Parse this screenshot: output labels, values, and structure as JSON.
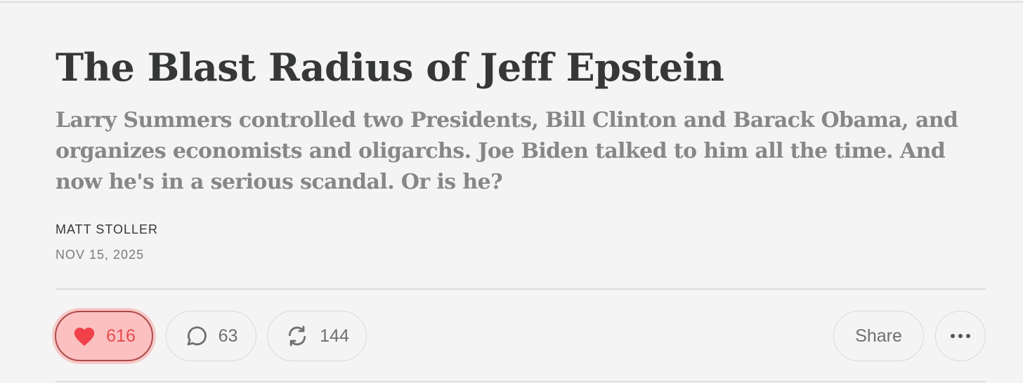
{
  "article": {
    "title": "The Blast Radius of Jeff Epstein",
    "subtitle": "Larry Summers controlled two Presidents, Bill Clinton and Barack Obama, and organizes economists and oligarchs. Joe Biden talked to him all the time. And now he's in a serious scandal. Or is he?",
    "author": "Matt Stoller",
    "date": "Nov 15, 2025"
  },
  "actions": {
    "like_count": "616",
    "comment_count": "63",
    "restack_count": "144",
    "share_label": "Share",
    "more_icon": "ellipsis-icon"
  },
  "colors": {
    "background": "#f4f4f4",
    "title": "#363737",
    "subtitle": "#868787",
    "like_fill": "#fbc0c0",
    "like_accent": "#f0414a",
    "icon_gray": "#6e6f6f"
  }
}
